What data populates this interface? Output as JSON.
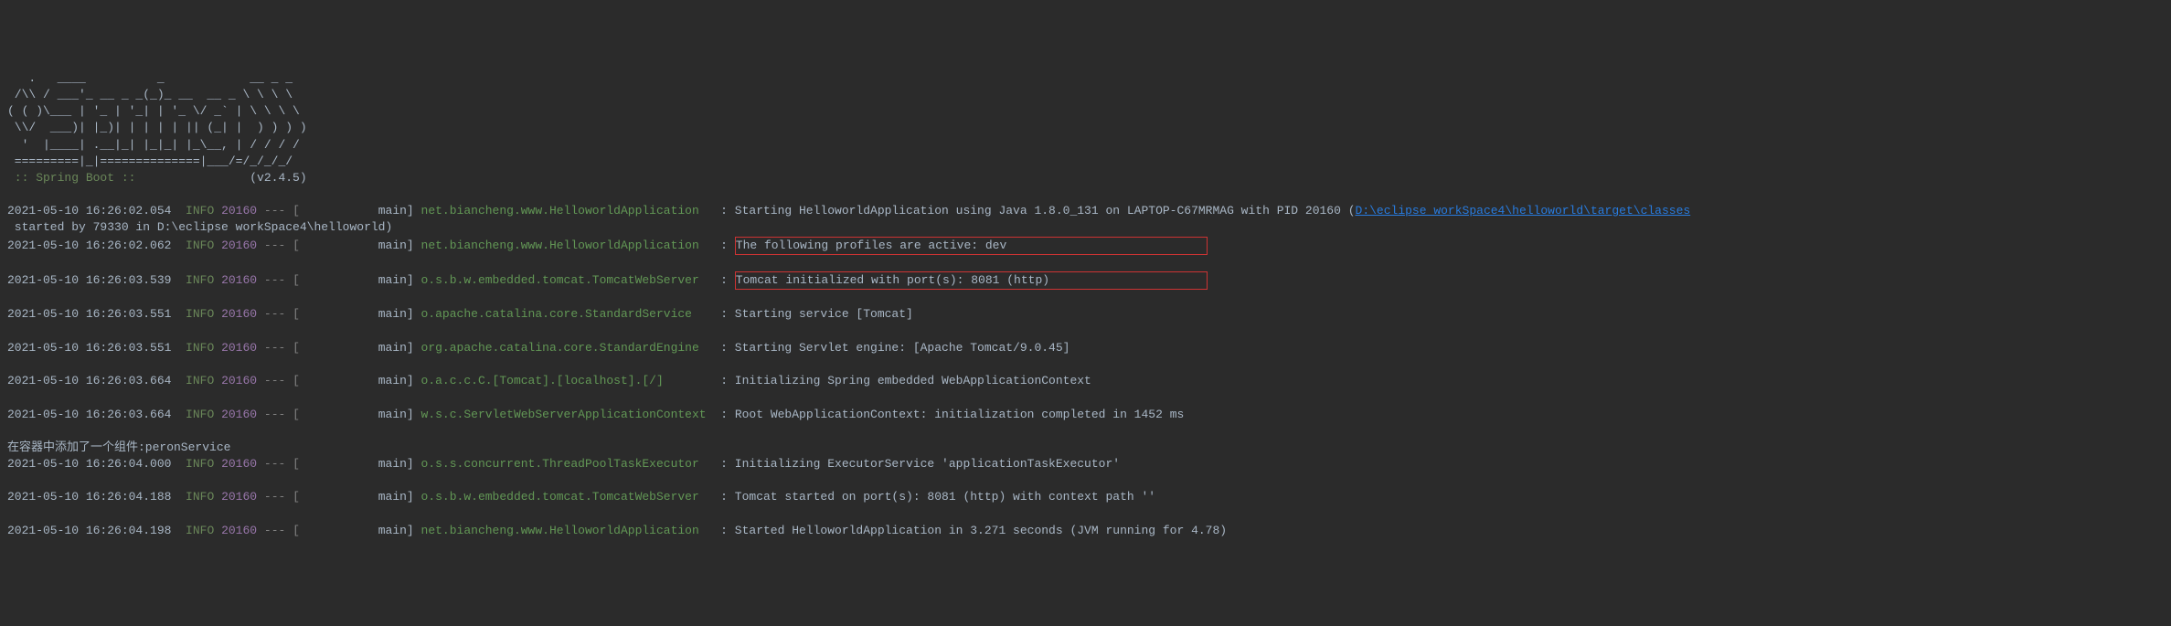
{
  "ascii": {
    "l1": "   .   ____          _            __ _ _",
    "l2": " /\\\\ / ___'_ __ _ _(_)_ __  __ _ \\ \\ \\ \\",
    "l3": "( ( )\\___ | '_ | '_| | '_ \\/ _` | \\ \\ \\ \\",
    "l4": " \\\\/  ___)| |_)| | | | | || (_| |  ) ) ) )",
    "l5": "  '  |____| .__|_| |_|_| |_\\__, | / / / /",
    "l6": " =========|_|==============|___/=/_/_/_/"
  },
  "springBoot": {
    "label": " :: Spring Boot :: ",
    "version": "               (v2.4.5)"
  },
  "logs": [
    {
      "ts": "2021-05-10 16:26:02.054",
      "level": "INFO",
      "pid": "20160",
      "sep": " --- [",
      "thread": "           main] ",
      "logger": "net.biancheng.www.HelloworldApplication",
      "colon": "   : ",
      "msg": "Starting HelloworldApplication using Java 1.8.0_131 on LAPTOP-C67MRMAG with PID 20160 (",
      "link": "D:\\eclipse workSpace4\\helloworld\\target\\classes",
      "cont": " started by 79330 in D:\\eclipse workSpace4\\helloworld)"
    },
    {
      "ts": "2021-05-10 16:26:02.062",
      "level": "INFO",
      "pid": "20160",
      "sep": " --- [",
      "thread": "           main] ",
      "logger": "net.biancheng.www.HelloworldApplication",
      "colon": "   : ",
      "msg": "The following profiles are active: dev",
      "highlighted": true
    },
    {
      "ts": "2021-05-10 16:26:03.539",
      "level": "INFO",
      "pid": "20160",
      "sep": " --- [",
      "thread": "           main] ",
      "logger": "o.s.b.w.embedded.tomcat.TomcatWebServer",
      "colon": "   : ",
      "msg": "Tomcat initialized with port(s): 8081 (http)",
      "highlighted": true
    },
    {
      "ts": "2021-05-10 16:26:03.551",
      "level": "INFO",
      "pid": "20160",
      "sep": " --- [",
      "thread": "           main] ",
      "logger": "o.apache.catalina.core.StandardService",
      "colon": "    : ",
      "msg": "Starting service [Tomcat]"
    },
    {
      "ts": "2021-05-10 16:26:03.551",
      "level": "INFO",
      "pid": "20160",
      "sep": " --- [",
      "thread": "           main] ",
      "logger": "org.apache.catalina.core.StandardEngine",
      "colon": "   : ",
      "msg": "Starting Servlet engine: [Apache Tomcat/9.0.45]"
    },
    {
      "ts": "2021-05-10 16:26:03.664",
      "level": "INFO",
      "pid": "20160",
      "sep": " --- [",
      "thread": "           main] ",
      "logger": "o.a.c.c.C.[Tomcat].[localhost].[/]",
      "colon": "        : ",
      "msg": "Initializing Spring embedded WebApplicationContext"
    },
    {
      "ts": "2021-05-10 16:26:03.664",
      "level": "INFO",
      "pid": "20160",
      "sep": " --- [",
      "thread": "           main] ",
      "logger": "w.s.c.ServletWebServerApplicationContext",
      "colon": "  : ",
      "msg": "Root WebApplicationContext: initialization completed in 1452 ms"
    }
  ],
  "chinese": "在容器中添加了一个组件:peronService",
  "logs2": [
    {
      "ts": "2021-05-10 16:26:04.000",
      "level": "INFO",
      "pid": "20160",
      "sep": " --- [",
      "thread": "           main] ",
      "logger": "o.s.s.concurrent.ThreadPoolTaskExecutor",
      "colon": "   : ",
      "msg": "Initializing ExecutorService 'applicationTaskExecutor'"
    },
    {
      "ts": "2021-05-10 16:26:04.188",
      "level": "INFO",
      "pid": "20160",
      "sep": " --- [",
      "thread": "           main] ",
      "logger": "o.s.b.w.embedded.tomcat.TomcatWebServer",
      "colon": "   : ",
      "msg": "Tomcat started on port(s): 8081 (http) with context path ''"
    },
    {
      "ts": "2021-05-10 16:26:04.198",
      "level": "INFO",
      "pid": "20160",
      "sep": " --- [",
      "thread": "           main] ",
      "logger": "net.biancheng.www.HelloworldApplication",
      "colon": "   : ",
      "msg": "Started HelloworldApplication in 3.271 seconds (JVM running for 4.78)"
    }
  ]
}
